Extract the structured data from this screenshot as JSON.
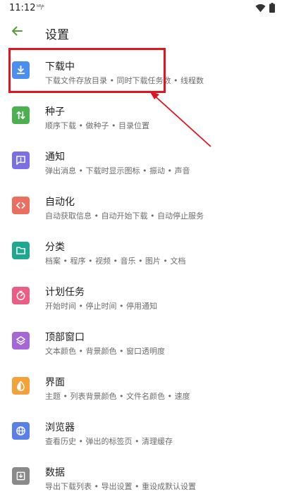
{
  "status_bar": {
    "time": "11:12",
    "extra": "ᵏᴮ/ˢ"
  },
  "app_bar": {
    "title": "设置",
    "back_icon": "arrow-back-icon",
    "accent": "#5a9a3a"
  },
  "items": [
    {
      "title": "下载中",
      "subtitle": "下载文件存放目录 • 同时下载任务数 • 线程数",
      "icon": "download-icon",
      "color": "#4a8ef0"
    },
    {
      "title": "种子",
      "subtitle": "顺序下载 • 做种子 • 目录位置",
      "icon": "swap-vert-icon",
      "color": "#4caf50"
    },
    {
      "title": "通知",
      "subtitle": "弹出消息 • 下载时显示图标 • 振动 • 声音",
      "icon": "feedback-icon",
      "color": "#7c6ee6"
    },
    {
      "title": "自动化",
      "subtitle": "自动获取信息 • 自动开始下载 • 自动停止服务",
      "icon": "code-icon",
      "color": "#ec6e5e"
    },
    {
      "title": "分类",
      "subtitle": "档案 • 程序 • 视频 • 音乐 • 图片 • 文档",
      "icon": "folder-icon",
      "color": "#1fa890"
    },
    {
      "title": "计划任务",
      "subtitle": "开始时间 • 停止时间 • 停用通知",
      "icon": "timer-icon",
      "color": "#ec5d85"
    },
    {
      "title": "顶部窗口",
      "subtitle": "文本颜色 • 背景颜色 • 窗口透明度",
      "icon": "layers-icon",
      "color": "#a566d6"
    },
    {
      "title": "界面",
      "subtitle": "主题 • 列表背景颜色 • 文件名颜色 • 速度",
      "icon": "contrast-icon",
      "color": "#f5a13a"
    },
    {
      "title": "浏览器",
      "subtitle": "查看历史 • 弹出的标签页 • 清理缓存",
      "icon": "globe-icon",
      "color": "#5b7fe8"
    },
    {
      "title": "数据",
      "subtitle": "导出下载列表 • 导出设置 • 重设成默认设置",
      "icon": "save-icon",
      "color": "#8a8a8a"
    }
  ],
  "annotation": {
    "highlight_color": "#e3141d"
  }
}
